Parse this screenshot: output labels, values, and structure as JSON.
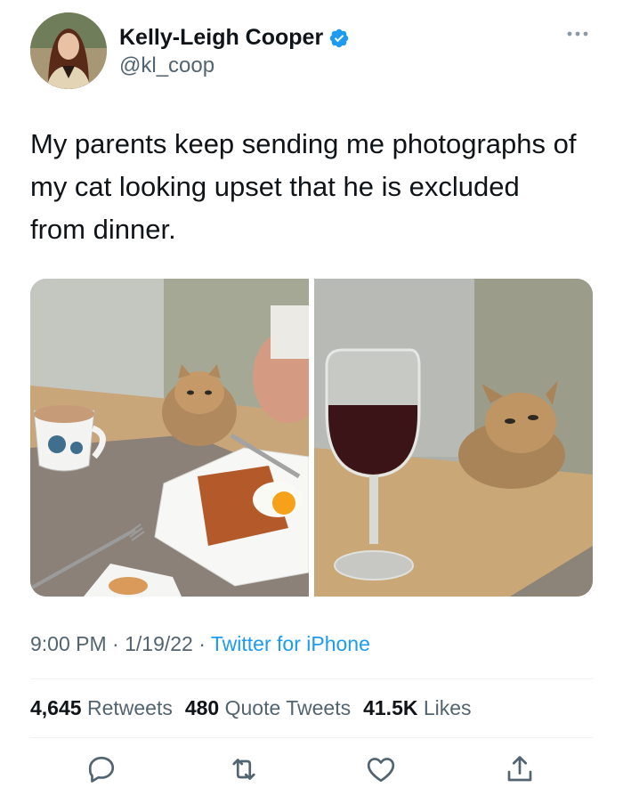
{
  "user": {
    "name": "Kelly-Leigh Cooper",
    "handle": "@kl_coop"
  },
  "tweet": {
    "text": "My parents keep sending me photographs of my cat looking upset that he is excluded from dinner."
  },
  "meta": {
    "time": "9:00 PM",
    "sep1": "·",
    "date": "1/19/22",
    "sep2": "·",
    "source": "Twitter for iPhone"
  },
  "stats": {
    "retweets_count": "4,645",
    "retweets_label": "Retweets",
    "quotes_count": "480",
    "quotes_label": "Quote Tweets",
    "likes_count": "41.5K",
    "likes_label": "Likes"
  },
  "icons": [
    "verified-badge-icon",
    "more-icon",
    "reply-icon",
    "retweet-icon",
    "like-icon",
    "share-icon"
  ],
  "colors": {
    "verified": "#1d9bf0",
    "link": "#1d9bf0",
    "secondary": "#536471"
  }
}
